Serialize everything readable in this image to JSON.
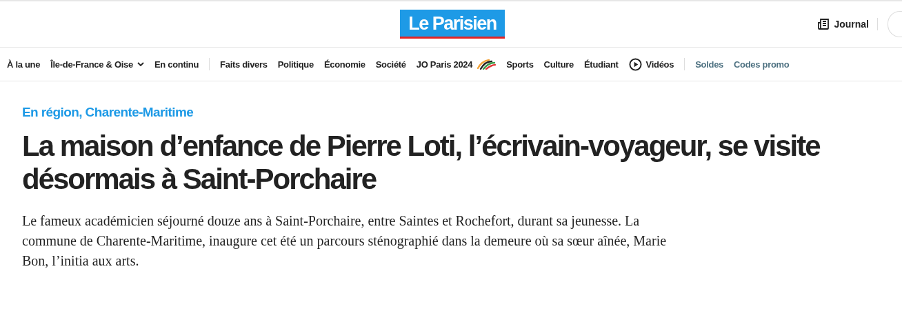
{
  "header": {
    "logo": "Le Parisien",
    "journal_link": "Journal"
  },
  "nav": [
    {
      "label": "À la une",
      "kind": "link"
    },
    {
      "label": "Île-de-France & Oise",
      "kind": "dropdown"
    },
    {
      "label": "En continu",
      "kind": "link"
    },
    {
      "kind": "divider"
    },
    {
      "label": "Faits divers",
      "kind": "link"
    },
    {
      "label": "Politique",
      "kind": "link"
    },
    {
      "label": "Économie",
      "kind": "link"
    },
    {
      "label": "Société",
      "kind": "link"
    },
    {
      "label": "JO Paris 2024",
      "kind": "olympics"
    },
    {
      "label": "Sports",
      "kind": "link"
    },
    {
      "label": "Culture",
      "kind": "link"
    },
    {
      "label": "Étudiant",
      "kind": "link"
    },
    {
      "label": "Vidéos",
      "kind": "video"
    },
    {
      "kind": "divider"
    },
    {
      "label": "Soldes",
      "kind": "promo"
    },
    {
      "label": "Codes promo",
      "kind": "promo"
    }
  ],
  "article": {
    "breadcrumb": "En région, Charente-Maritime",
    "headline": "La maison d’enfance de Pierre Loti, l’écrivain-voyageur, se visite désormais à Saint-Porchaire",
    "lead": "Le fameux académicien séjourné douze ans à Saint-Porchaire, entre Saintes et Rochefort, durant sa jeunesse. La commune de Charente-Maritime, inaugure cet été un parcours sténographié dans la demeure où sa sœur aînée, Marie Bon, l’initia aux arts."
  }
}
